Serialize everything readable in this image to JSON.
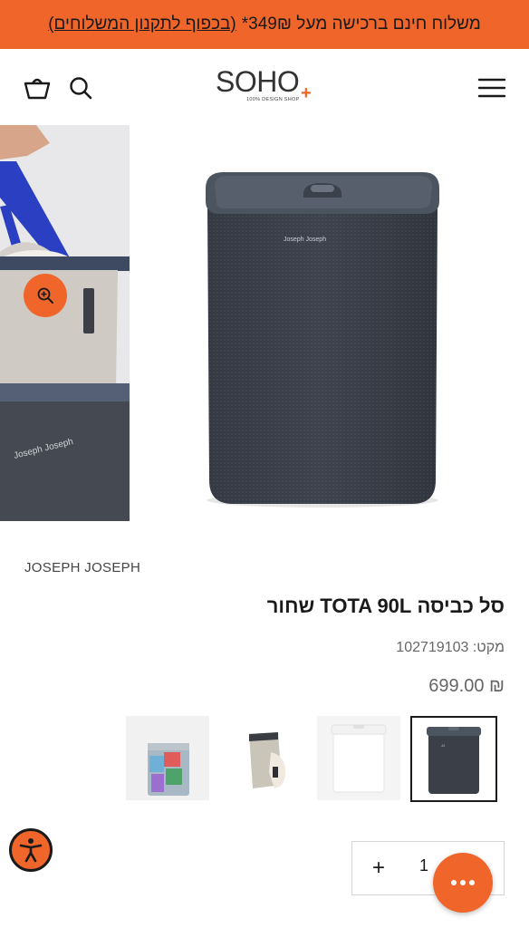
{
  "promo": {
    "text": "משלוח חינם ברכישה מעל 349₪*",
    "link": "(בכפוף לתקנון המשלוחים)"
  },
  "header": {
    "logo_text": "SOHO",
    "logo_tagline": "100% DESIGN SHOP",
    "icons": [
      "cart-icon",
      "search-icon",
      "menu-icon"
    ]
  },
  "gallery": {
    "main_label_brand": "Joseph Joseph",
    "side_label_brand": "Joseph Joseph"
  },
  "product": {
    "vendor": "JOSEPH JOSEPH",
    "title": "סל כביסה TOTA 90L שחור",
    "sku": "מקט: 102719103",
    "price": "₪ 699.00"
  },
  "quantity": {
    "value": "1",
    "plus_label": "+"
  },
  "colors": {
    "accent": "#f0652a",
    "bin_dark": "#3a3f48"
  }
}
